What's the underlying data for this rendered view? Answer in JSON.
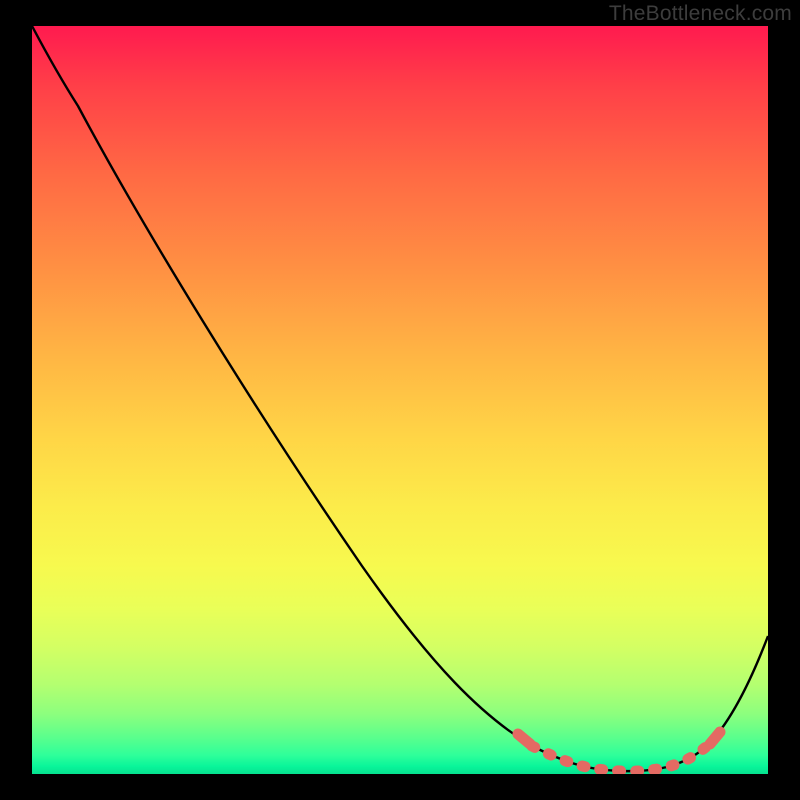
{
  "watermark": "TheBottleneck.com",
  "chart_data": {
    "type": "line",
    "title": "",
    "xlabel": "",
    "ylabel": "",
    "xlim": [
      0,
      100
    ],
    "ylim": [
      0,
      100
    ],
    "series": [
      {
        "name": "curve",
        "x": [
          0,
          3,
          8,
          15,
          25,
          35,
          45,
          55,
          62,
          68,
          72,
          76,
          80,
          84,
          88,
          92,
          95,
          98,
          100
        ],
        "y": [
          100,
          96,
          90,
          82,
          70,
          58,
          46,
          33,
          24,
          15,
          9,
          5,
          2,
          1,
          1,
          2,
          6,
          14,
          24
        ]
      },
      {
        "name": "highlight-band",
        "x": [
          70,
          73,
          76,
          79,
          82,
          85,
          88,
          91,
          93
        ],
        "y": [
          10,
          6,
          4,
          2,
          1,
          1,
          2,
          4,
          7
        ]
      }
    ],
    "gradient_stops": [
      {
        "pos": 0.0,
        "color": "#ff1a4f"
      },
      {
        "pos": 0.5,
        "color": "#ffd546"
      },
      {
        "pos": 0.75,
        "color": "#f7f94e"
      },
      {
        "pos": 1.0,
        "color": "#06e18f"
      }
    ]
  }
}
